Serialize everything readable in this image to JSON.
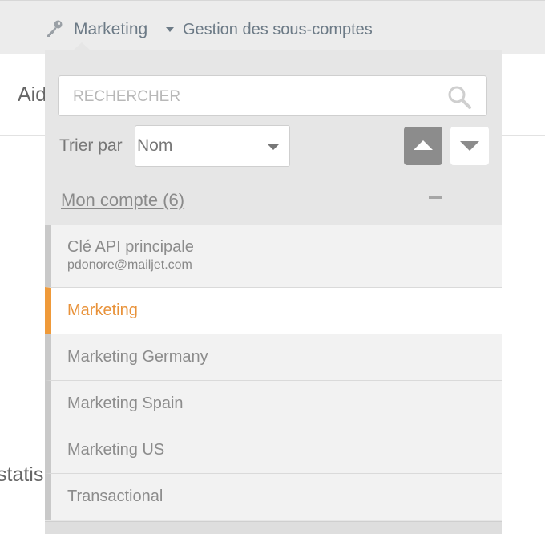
{
  "header": {
    "account_name": "Marketing",
    "subaccounts_link": "Gestion des sous-comptes"
  },
  "background": {
    "aide_partial": "Aid",
    "statis_partial": "statis"
  },
  "dropdown": {
    "search": {
      "placeholder": "RECHERCHER",
      "value": ""
    },
    "sort": {
      "label": "Trier par",
      "selected": "Nom"
    },
    "group": {
      "title": "Mon compte (6)",
      "collapse_symbol": "−"
    },
    "items": [
      {
        "label": "Clé API principale",
        "email": "pdonore@mailjet.com",
        "active": false
      },
      {
        "label": "Marketing",
        "active": true
      },
      {
        "label": "Marketing Germany",
        "active": false
      },
      {
        "label": "Marketing Spain",
        "active": false
      },
      {
        "label": "Marketing US",
        "active": false
      },
      {
        "label": "Transactional",
        "active": false
      }
    ]
  },
  "colors": {
    "accent_active": "#ef9a3a",
    "header_text": "#6c7a86",
    "panel_bg": "#e6e6e6"
  },
  "icons": {
    "key": "key-icon",
    "search": "search-icon",
    "caret": "caret-down-icon",
    "sort_asc": "sort-ascending-icon",
    "sort_desc": "sort-descending-icon",
    "collapse": "collapse-icon"
  }
}
